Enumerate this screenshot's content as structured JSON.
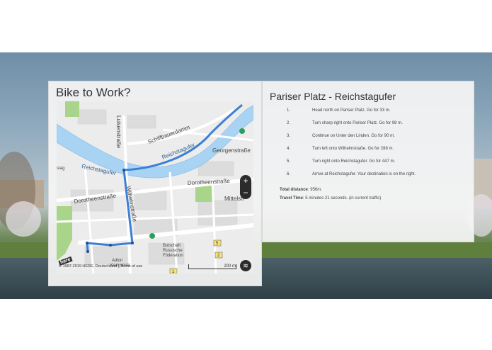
{
  "left_panel": {
    "title": "Bike to Work?"
  },
  "map": {
    "labels": {
      "schiffbauerdamm": "Schiffbauerdamm",
      "reichstagufer_top": "Reichstagufer",
      "georgenstrasse": "Georgenstraße",
      "luisenstrasse": "Luisenstraße",
      "reichstagufer_left": "Reichstagufer",
      "stag": "stag",
      "dorotheenstrasse_left": "Dorotheenstraße",
      "dorotheenstrasse_right": "Dorotheenstraße",
      "mittelstr": "Mittelstr",
      "wilhelmstrasse": "Wilhelmstraße",
      "botschaft": "Botschaft",
      "russische": "Russische",
      "foderation": "Föderation",
      "adlon": "Adlon",
      "kempinski": "Kempinski",
      "shield_5": "5",
      "shield_2": "2",
      "shield_1": "1"
    },
    "zoom_in": "+",
    "zoom_out": "−",
    "layers_icon": "≋",
    "copyright": "© 1987-2019 HERE, Deutschland | Terms of use",
    "scale": "200 m",
    "logo": "here",
    "colors": {
      "water": "#a9d3f2",
      "route": "#3c7fd6",
      "park": "#a8d58a"
    }
  },
  "directions": {
    "title": "Pariser Platz - Reichstagufer",
    "steps": [
      {
        "n": "1.",
        "text": "Head north on Pariser Platz. Go for 33 m."
      },
      {
        "n": "2.",
        "text": "Turn sharp right onto Pariser Platz. Go for 98 m."
      },
      {
        "n": "3.",
        "text": "Continue on Unter den Linden. Go for 90 m."
      },
      {
        "n": "4.",
        "text": "Turn left onto Wilhelmstraße. Go for 288 m."
      },
      {
        "n": "5.",
        "text": "Turn right onto Reichstagufer. Go for 447 m."
      },
      {
        "n": "6.",
        "text": "Arrive at Reichstagufer. Your destination is on the right."
      }
    ],
    "total_distance_label": "Total distance",
    "total_distance_value": ": 956m.",
    "travel_time_label": "Travel Time",
    "travel_time_value": ": 5 minutes 21 seconds. (in current traffic)"
  }
}
